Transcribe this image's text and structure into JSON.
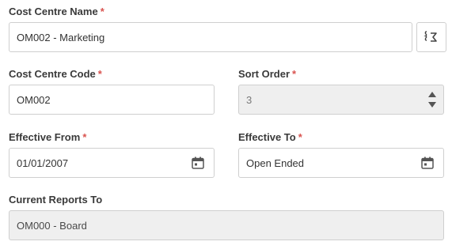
{
  "form": {
    "cost_centre_name": {
      "label": "Cost Centre Name",
      "required_mark": "*",
      "value": "OM002 - Marketing",
      "lookup_icon": "formula-lookup-icon"
    },
    "cost_centre_code": {
      "label": "Cost Centre Code",
      "required_mark": "*",
      "value": "OM002"
    },
    "sort_order": {
      "label": "Sort Order",
      "required_mark": "*",
      "value": "3",
      "stepper_icons": [
        "arrow-up-icon",
        "arrow-down-icon"
      ]
    },
    "effective_from": {
      "label": "Effective From",
      "required_mark": "*",
      "value": "01/01/2007",
      "icon": "calendar-icon"
    },
    "effective_to": {
      "label": "Effective To",
      "required_mark": "*",
      "value": "Open Ended",
      "icon": "calendar-icon"
    },
    "current_reports_to": {
      "label": "Current Reports To",
      "value": "OM000 - Board"
    }
  },
  "colors": {
    "required": "#d9534f",
    "border": "#cfcfcf",
    "readonly_bg": "#efefef"
  }
}
